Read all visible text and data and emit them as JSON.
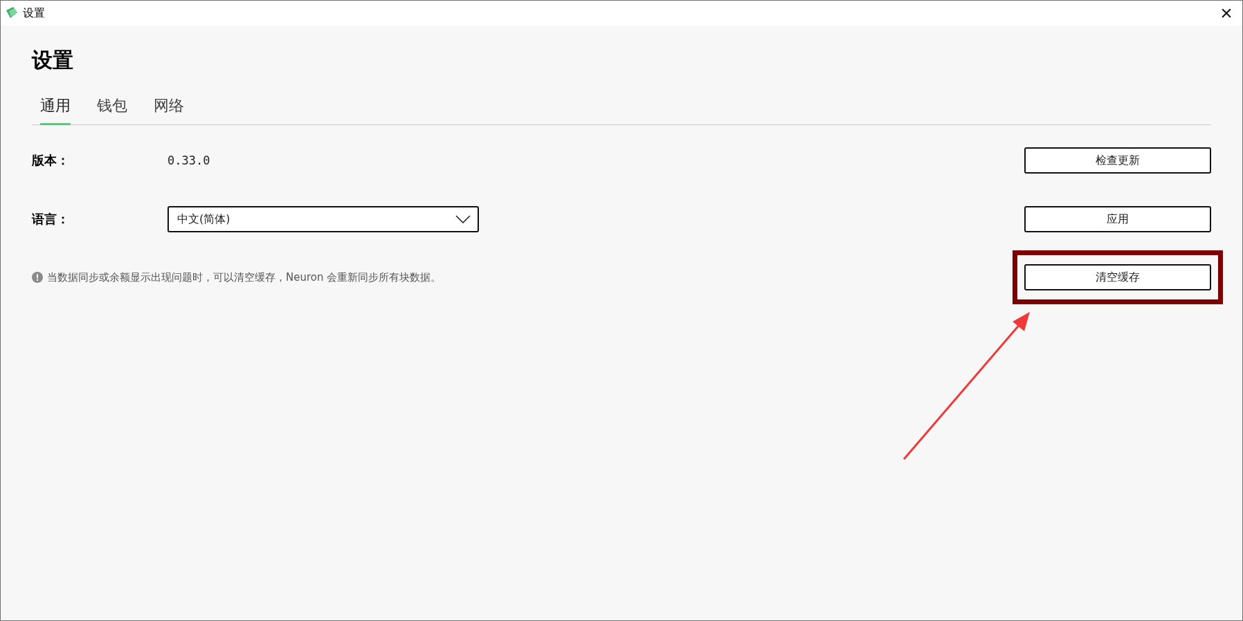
{
  "window": {
    "title": "设置",
    "close": "×"
  },
  "heading": "设置",
  "tabs": [
    {
      "label": "通用",
      "selected": true
    },
    {
      "label": "钱包",
      "selected": false
    },
    {
      "label": "网络",
      "selected": false
    }
  ],
  "version": {
    "label": "版本：",
    "value": "0.33.0",
    "button": "检查更新"
  },
  "language": {
    "label": "语言：",
    "value": "中文(简体)",
    "button": "应用"
  },
  "cache": {
    "hint": "当数据同步或余额显示出现问题时，可以清空缓存，Neuron 会重新同步所有块数据。",
    "button": "清空缓存",
    "highlighted": true
  }
}
